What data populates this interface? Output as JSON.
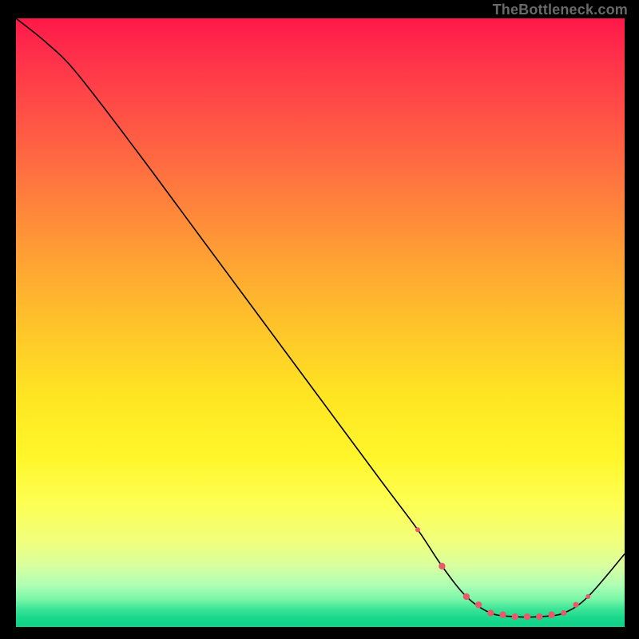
{
  "credit": "TheBottleneck.com",
  "chart_data": {
    "type": "line",
    "title": "",
    "xlabel": "",
    "ylabel": "",
    "xlim": [
      0,
      100
    ],
    "ylim": [
      0,
      100
    ],
    "series": [
      {
        "name": "curve",
        "x": [
          0,
          5,
          10,
          20,
          30,
          40,
          50,
          60,
          66,
          70,
          74,
          78,
          82,
          86,
          90,
          94,
          100
        ],
        "y": [
          100,
          96,
          91,
          78,
          64.5,
          51,
          37.5,
          24,
          16,
          10,
          5,
          2.3,
          1.7,
          1.7,
          2.3,
          5,
          12
        ]
      }
    ],
    "markers": {
      "name": "highlight",
      "color": "#e85a6a",
      "x": [
        66,
        70,
        74,
        76,
        78,
        80,
        82,
        84,
        86,
        88,
        90,
        92,
        94
      ],
      "r": [
        3.0,
        4.2,
        4.2,
        4.2,
        4.2,
        4.2,
        4.2,
        4.2,
        4.2,
        4.2,
        3.6,
        3.6,
        3.0
      ]
    }
  }
}
